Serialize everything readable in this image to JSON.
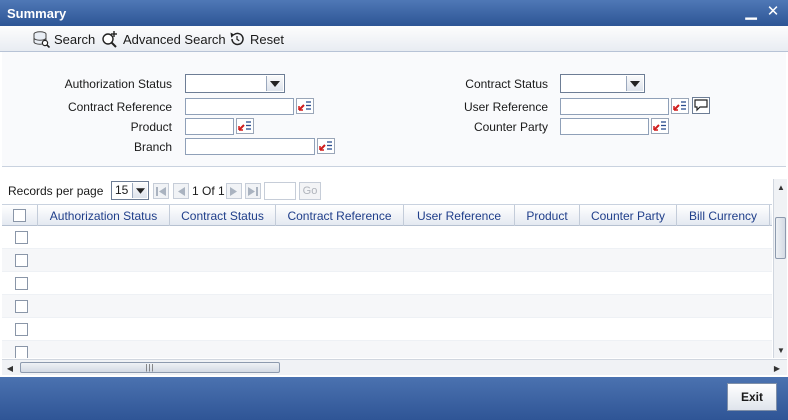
{
  "window": {
    "title": "Summary"
  },
  "toolbar": {
    "search": "Search",
    "advanced_search": "Advanced Search",
    "reset": "Reset"
  },
  "criteria": {
    "authorization_status": "Authorization Status",
    "contract_reference": "Contract Reference",
    "product": "Product",
    "branch": "Branch",
    "contract_status": "Contract Status",
    "user_reference": "User Reference",
    "counter_party": "Counter Party"
  },
  "pager": {
    "records_per_page": "Records per page",
    "page_size": "15",
    "page_info": "1 Of 1",
    "go": "Go"
  },
  "grid": {
    "columns": [
      "Authorization Status",
      "Contract Status",
      "Contract Reference",
      "User Reference",
      "Product",
      "Counter Party",
      "Bill Currency"
    ],
    "row_count": 6
  },
  "footer": {
    "exit": "Exit"
  },
  "colors": {
    "titlebar": "#2d5595",
    "header_text": "#1f3e8a",
    "lov_red": "#d01c1c"
  }
}
